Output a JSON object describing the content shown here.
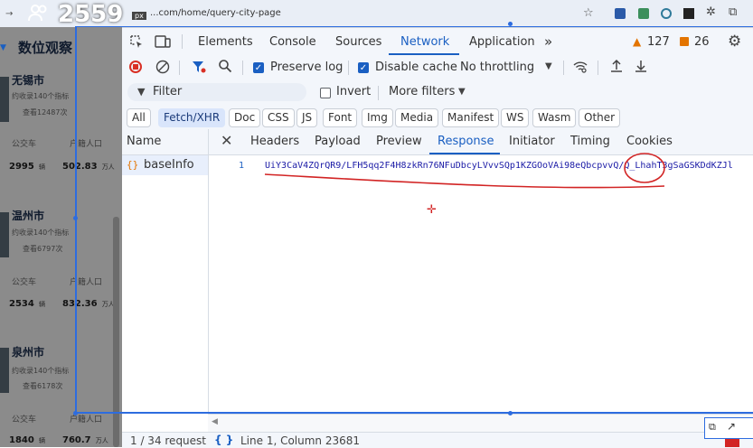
{
  "browser": {
    "url": "...com/home/query-city-page",
    "overlay_counter": "2559",
    "overlay_unit": "px"
  },
  "page": {
    "heading": "数位观察",
    "cities": [
      {
        "name": "无锡市",
        "desc": "约收录140个指标",
        "views": "查看12487次",
        "bus_label": "公交车",
        "bus_value": "2995",
        "bus_unit": "辆",
        "pop_label": "户籍人口",
        "pop_value": "502.83",
        "pop_unit": "万人"
      },
      {
        "name": "温州市",
        "desc": "约收录140个指标",
        "views": "查看6797次",
        "bus_label": "公交车",
        "bus_value": "2534",
        "bus_unit": "辆",
        "pop_label": "户籍人口",
        "pop_value": "832.36",
        "pop_unit": "万人"
      },
      {
        "name": "泉州市",
        "desc": "约收录140个指标",
        "views": "查看6178次",
        "bus_label": "公交车",
        "bus_value": "1840",
        "bus_unit": "辆",
        "pop_label": "户籍人口",
        "pop_value": "760.7",
        "pop_unit": "万人"
      }
    ]
  },
  "devtools": {
    "tabs": [
      "Elements",
      "Console",
      "Sources",
      "Network",
      "Application"
    ],
    "active_tab": "Network",
    "warnings_count": "127",
    "issues_count": "26",
    "toolbar": {
      "preserve_log": "Preserve log",
      "disable_cache": "Disable cache",
      "throttling": "No throttling"
    },
    "filter": {
      "placeholder": "Filter",
      "invert": "Invert",
      "more_filters": "More filters"
    },
    "type_filters": [
      "All",
      "Fetch/XHR",
      "Doc",
      "CSS",
      "JS",
      "Font",
      "Img",
      "Media",
      "Manifest",
      "WS",
      "Wasm",
      "Other"
    ],
    "active_type_filter": "Fetch/XHR",
    "name_header": "Name",
    "request_name": "baseInfo",
    "response_tabs": [
      "Headers",
      "Payload",
      "Preview",
      "Response",
      "Initiator",
      "Timing",
      "Cookies"
    ],
    "active_response_tab": "Response",
    "line_number": "1",
    "response_text": "UiY3CaV4ZQrQR9/LFH5qq2F4H8zkRn76NFuDbcyLVvvSQp1KZGOoVAi98eQbcpvvQ/Q_LhahT3gSaGSKDdKZJl",
    "status_requests": "1 / 34 request",
    "status_position": "Line 1, Column 23681"
  },
  "colors": {
    "accent": "#1a5fc2",
    "annotation_red": "#d22424",
    "selection_blue": "#2d6cdf"
  }
}
